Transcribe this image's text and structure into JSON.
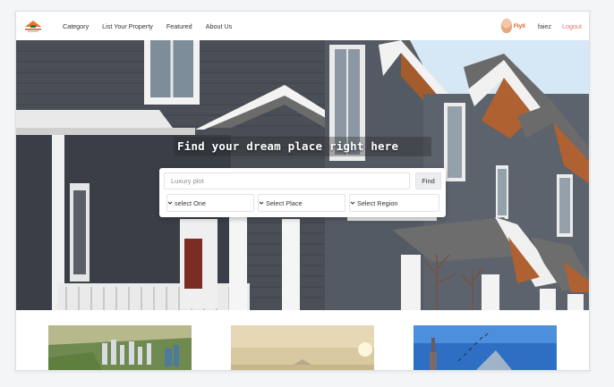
{
  "nav": {
    "logo_icon": "house-logo",
    "links": [
      "Category",
      "List Your Property",
      "Featured",
      "About Us"
    ],
    "brand_tag": "Flyll",
    "username": "faiez",
    "logout_label": "Logout",
    "accent_color": "#e0707a"
  },
  "hero": {
    "title": "Find your dream place right here",
    "search_placeholder": "Luxury plot",
    "find_label": "Find",
    "selects": [
      "select One",
      "Select Place",
      "Select Region"
    ],
    "select_icon": "chevron-down-icon"
  },
  "cards": [
    {
      "image": "aerial-housing-development-photo"
    },
    {
      "image": "sunset-building-photo"
    },
    {
      "image": "glass-building-photo"
    }
  ]
}
